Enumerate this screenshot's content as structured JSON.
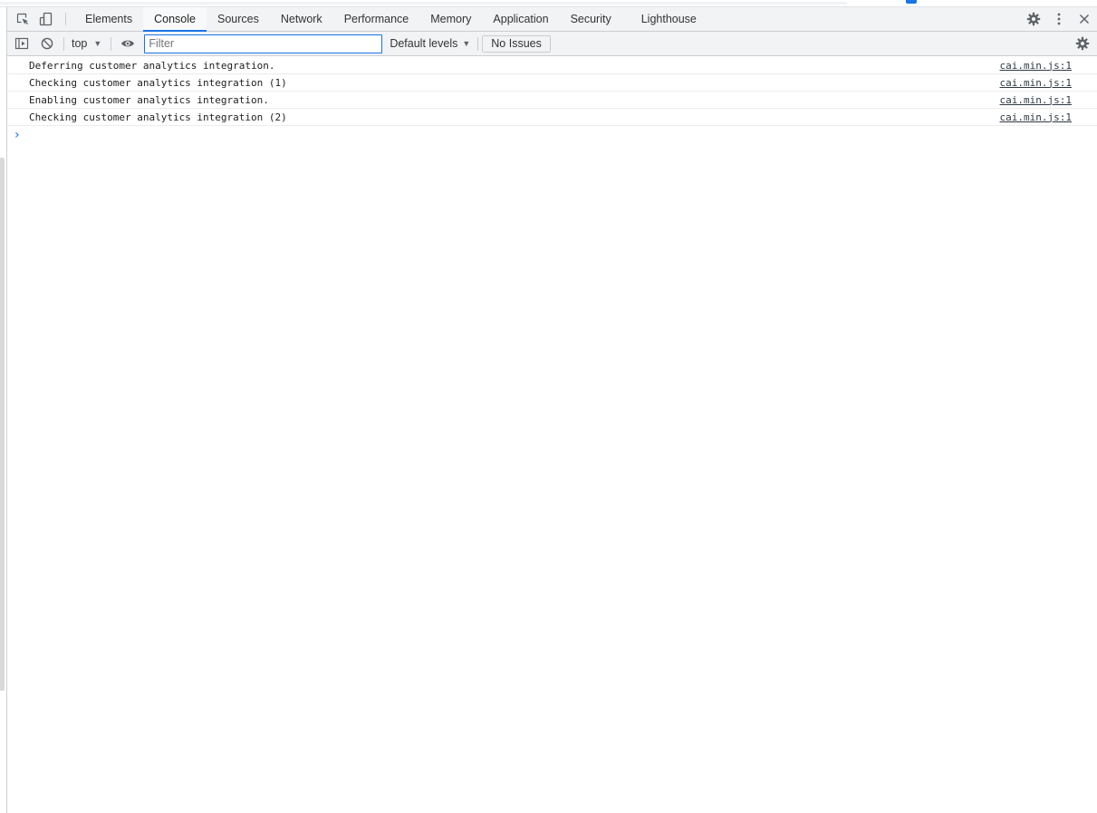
{
  "tabs": [
    {
      "label": "Elements",
      "active": false
    },
    {
      "label": "Console",
      "active": true
    },
    {
      "label": "Sources",
      "active": false
    },
    {
      "label": "Network",
      "active": false
    },
    {
      "label": "Performance",
      "active": false
    },
    {
      "label": "Memory",
      "active": false
    },
    {
      "label": "Application",
      "active": false
    },
    {
      "label": "Security",
      "active": false
    },
    {
      "label": "Lighthouse",
      "active": false
    }
  ],
  "toolbar": {
    "context": "top",
    "filter_placeholder": "Filter",
    "filter_value": "",
    "levels": "Default levels",
    "issues": "No Issues"
  },
  "messages": [
    {
      "text": "Deferring customer analytics integration.",
      "source": "cai.min.js:1"
    },
    {
      "text": "Checking customer analytics integration (1)",
      "source": "cai.min.js:1"
    },
    {
      "text": "Enabling customer analytics integration.",
      "source": "cai.min.js:1"
    },
    {
      "text": "Checking customer analytics integration (2)",
      "source": "cai.min.js:1"
    }
  ],
  "icons": {
    "inspect": "inspect-element-icon",
    "device": "device-toolbar-icon",
    "settings": "gear-icon",
    "more": "kebab-menu-icon",
    "close": "close-icon",
    "sidebar": "sidebar-toggle-icon",
    "clear": "clear-console-icon",
    "eye": "eye-icon",
    "prompt": "chevron-right-icon"
  },
  "colors": {
    "accent": "#1a73e8",
    "toolbar_bg": "#f1f3f4",
    "border": "#cbcdd1"
  }
}
